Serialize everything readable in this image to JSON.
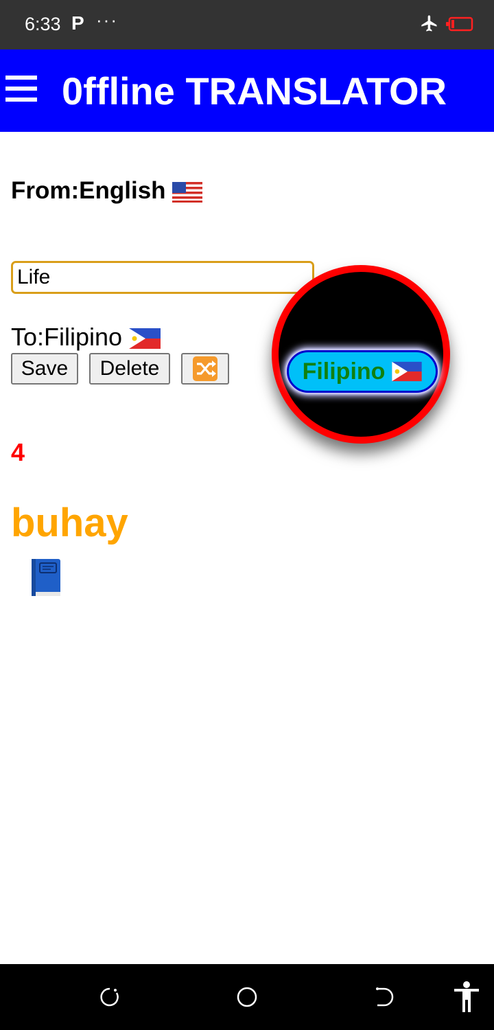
{
  "status_bar": {
    "time": "6:33",
    "p_icon": "P",
    "dots": "···",
    "icons": [
      "airplane-icon",
      "battery-icon"
    ]
  },
  "header": {
    "title": "0ffline TRANSLATOR",
    "menu_icon": "hamburger-menu-icon",
    "background_color": "#0000ff"
  },
  "from": {
    "label": "From:English",
    "flag": "us-flag-icon"
  },
  "input": {
    "value": "Life",
    "border_color": "#d99e1a"
  },
  "to": {
    "label": "To:Filipino",
    "flag": "philippines-flag-icon"
  },
  "buttons": {
    "save": "Save",
    "delete": "Delete",
    "shuffle_icon": "shuffle-icon"
  },
  "count": "4",
  "result": {
    "text": "buhay",
    "color": "#ffa500",
    "icon": "blue-book-icon"
  },
  "floating_selector": {
    "language": "Filipino",
    "flag": "philippines-flag-icon",
    "ring_color": "#ff0000",
    "pill_color": "#00c0f8",
    "text_color": "#108010"
  },
  "nav_bar": {
    "icons": [
      "recents-icon",
      "home-icon",
      "back-icon",
      "accessibility-icon"
    ]
  }
}
